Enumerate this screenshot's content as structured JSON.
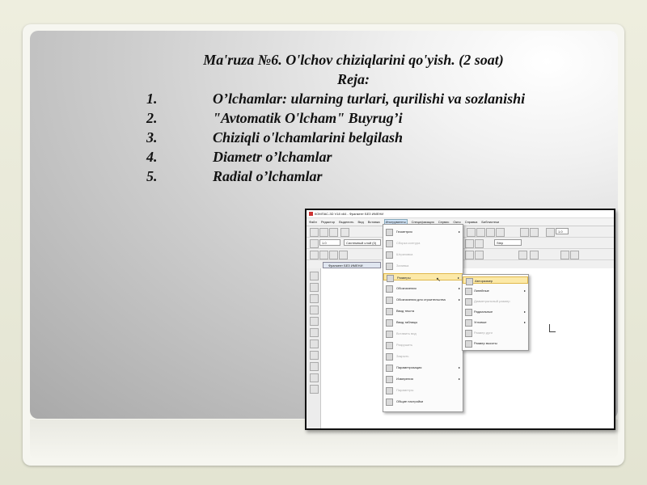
{
  "slide": {
    "title": "Ma'ruza №6. O'lchov chiziqlarini qo'yish. (2 soat)",
    "subtitle": "Reja:",
    "plan": [
      {
        "num": "1.",
        "text": "O’lchamlar: ularning turlari, qurilishi va sozlanishi"
      },
      {
        "num": "2.",
        "text": "\"Avtomatik O'lcham\" Buyrug’i"
      },
      {
        "num": "3.",
        "text": "Chiziqli o'lchamlarini belgilash"
      },
      {
        "num": "4.",
        "text": "Diametr o’lchamlar"
      },
      {
        "num": "5.",
        "text": "Radial o’lchamlar"
      }
    ]
  },
  "screenshot": {
    "window_title": "КОМПАС-3D V18 x64 - Фрагмент БЕЗ ИМЕНИ",
    "menu": [
      "Файл",
      "Редактор",
      "Выделить",
      "Вид",
      "Вставка",
      "Инструменты",
      "Спецификация",
      "Сервис",
      "Окно",
      "Справка",
      "Библиотеки"
    ],
    "active_menu": "Инструменты",
    "document_tab": "Фрагмент БЕЗ ИМЕНИ",
    "scale_field": "1.0",
    "layer_field": "Системный слой (0)",
    "step_field": "Step",
    "dropdown": [
      {
        "label": "Геометрия",
        "state": "normal",
        "arrow": "▸"
      },
      {
        "label": "Сборка контура",
        "state": "disabled",
        "arrow": ""
      },
      {
        "label": "Штриховка",
        "state": "disabled",
        "arrow": ""
      },
      {
        "label": "Заливка",
        "state": "disabled",
        "arrow": ""
      },
      {
        "label": "Размеры",
        "state": "active",
        "arrow": "▸"
      },
      {
        "label": "Обозначения",
        "state": "normal",
        "arrow": "▸"
      },
      {
        "label": "Обозначения для строительства",
        "state": "normal",
        "arrow": "▸"
      },
      {
        "label": "Ввод текста",
        "state": "normal",
        "arrow": ""
      },
      {
        "label": "Ввод таблицы",
        "state": "normal",
        "arrow": ""
      },
      {
        "label": "Вставить вид",
        "state": "disabled",
        "arrow": ""
      },
      {
        "label": "Разрушить",
        "state": "disabled",
        "arrow": ""
      },
      {
        "label": "Закрыть",
        "state": "disabled",
        "arrow": ""
      },
      {
        "label": "Параметризация",
        "state": "normal",
        "arrow": "▸"
      },
      {
        "label": "Измерения",
        "state": "normal",
        "arrow": "▸"
      },
      {
        "label": "Параметры",
        "state": "disabled",
        "arrow": ""
      },
      {
        "label": "Общие настройки",
        "state": "normal",
        "arrow": ""
      }
    ],
    "submenu": [
      {
        "label": "Авторазмер",
        "state": "active",
        "arrow": ""
      },
      {
        "label": "Линейные",
        "state": "normal",
        "arrow": "▸"
      },
      {
        "label": "Диаметральный размер",
        "state": "disabled",
        "arrow": ""
      },
      {
        "label": "Радиальные",
        "state": "normal",
        "arrow": "▸"
      },
      {
        "label": "Угловые",
        "state": "normal",
        "arrow": "▸"
      },
      {
        "label": "Размер дуги",
        "state": "disabled",
        "arrow": ""
      },
      {
        "label": "Размер высоты",
        "state": "normal",
        "arrow": ""
      }
    ]
  }
}
